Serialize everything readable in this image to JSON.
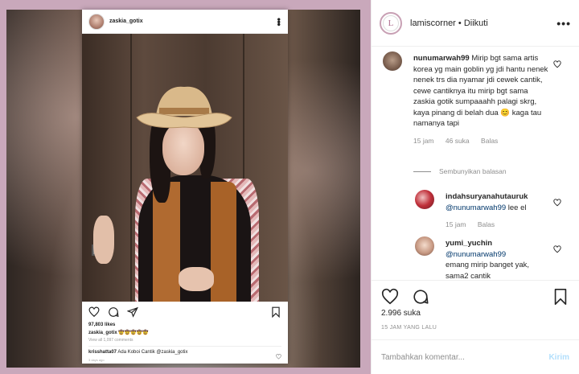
{
  "post_card": {
    "username": "zaskia_gotix",
    "likes": "97,803 likes",
    "caption_user": "zaskia_gotix",
    "caption_text": "🤠🤠🤠🤠🤠",
    "view_all": "View all 1,097 comments",
    "comment_user": "krisshatta07",
    "comment_text": "Ada Koboi Cantik @zaskia_gotix",
    "time": "3 days ago"
  },
  "header": {
    "username": "lamiscorner",
    "separator": " • ",
    "follow_status": "Diikuti",
    "avatar_letter": "L"
  },
  "comments": [
    {
      "username": "nunumarwah99",
      "text": "Mirip bgt sama artis korea yg main goblin yg jdi hantu nenek nenek trs dia nyamar jdi cewek cantik, cewe cantiknya itu mirip bgt sama zaskia gotik sumpaaahh palagi skrg, kaya pinang di belah dua 😊 kaga tau namanya tapi",
      "time": "15 jam",
      "likes": "46 suka",
      "reply": "Balas"
    }
  ],
  "hide_replies": "Sembunyikan balasan",
  "replies": [
    {
      "username": "indahsuryanahutauruk",
      "mention": "@nunumarwah99",
      "text": " lee el",
      "time": "15 jam",
      "reply": "Balas"
    },
    {
      "username": "yumi_yuchin",
      "mention": "@nunumarwah99",
      "text": "emang mirip banget yak, sama2 cantik"
    }
  ],
  "likes_count": "2.996 suka",
  "post_date": "15 JAM YANG LALU",
  "comment_input": {
    "placeholder": "Tambahkan komentar..."
  },
  "post_button": "Kirim",
  "colors": {
    "frame": "#c9a8bb",
    "post_button": "#b2dffc",
    "mention": "#00376b",
    "meta": "#8e8e8e"
  }
}
